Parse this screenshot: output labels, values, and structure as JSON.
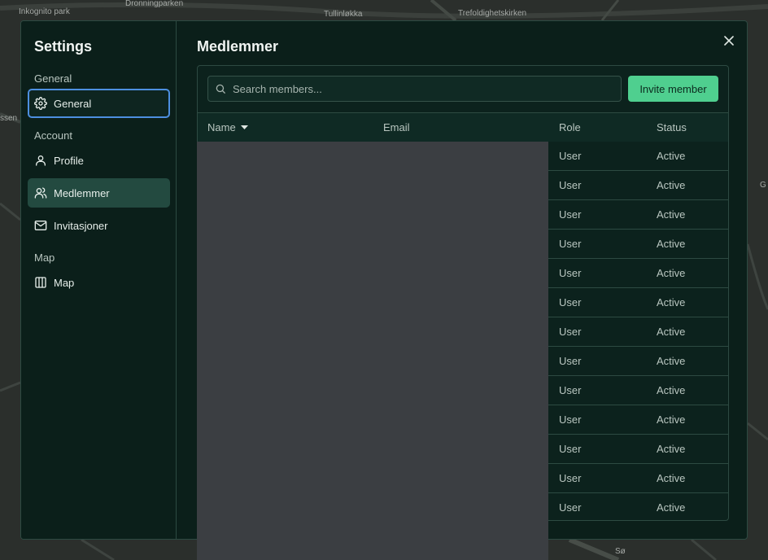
{
  "map": {
    "labels": [
      "Inkognito park",
      "Dronningparken",
      "Tullinløkka",
      "Trefoldighetskirken",
      "ssen",
      "Sø",
      "G"
    ]
  },
  "sidebar": {
    "title": "Settings",
    "groups": [
      {
        "label": "General",
        "items": [
          {
            "label": "General",
            "icon": "gear-icon"
          }
        ]
      },
      {
        "label": "Account",
        "items": [
          {
            "label": "Profile",
            "icon": "user-icon"
          },
          {
            "label": "Medlemmer",
            "icon": "users-icon"
          },
          {
            "label": "Invitasjoner",
            "icon": "mail-icon"
          }
        ]
      },
      {
        "label": "Map",
        "items": [
          {
            "label": "Map",
            "icon": "map-icon"
          }
        ]
      }
    ]
  },
  "main": {
    "title": "Medlemmer",
    "search": {
      "placeholder": "Search members...",
      "value": ""
    },
    "invite_label": "Invite member",
    "columns": {
      "name": "Name",
      "email": "Email",
      "role": "Role",
      "status": "Status"
    },
    "sort": {
      "column": "Name",
      "direction": "descending"
    },
    "rows": [
      {
        "role": "User",
        "status": "Active"
      },
      {
        "role": "User",
        "status": "Active"
      },
      {
        "role": "User",
        "status": "Active"
      },
      {
        "role": "User",
        "status": "Active"
      },
      {
        "role": "User",
        "status": "Active"
      },
      {
        "role": "User",
        "status": "Active"
      },
      {
        "role": "User",
        "status": "Active"
      },
      {
        "role": "User",
        "status": "Active"
      },
      {
        "role": "User",
        "status": "Active"
      },
      {
        "role": "User",
        "status": "Active"
      },
      {
        "role": "User",
        "status": "Active"
      },
      {
        "role": "User",
        "status": "Active"
      },
      {
        "role": "User",
        "status": "Active"
      }
    ]
  },
  "colors": {
    "accent": "#4fcf8f",
    "dialog_bg": "#0b1f1a",
    "active_item": "#234a40",
    "focus_ring": "#4d8fe0",
    "redaction": "#3b3e42"
  }
}
